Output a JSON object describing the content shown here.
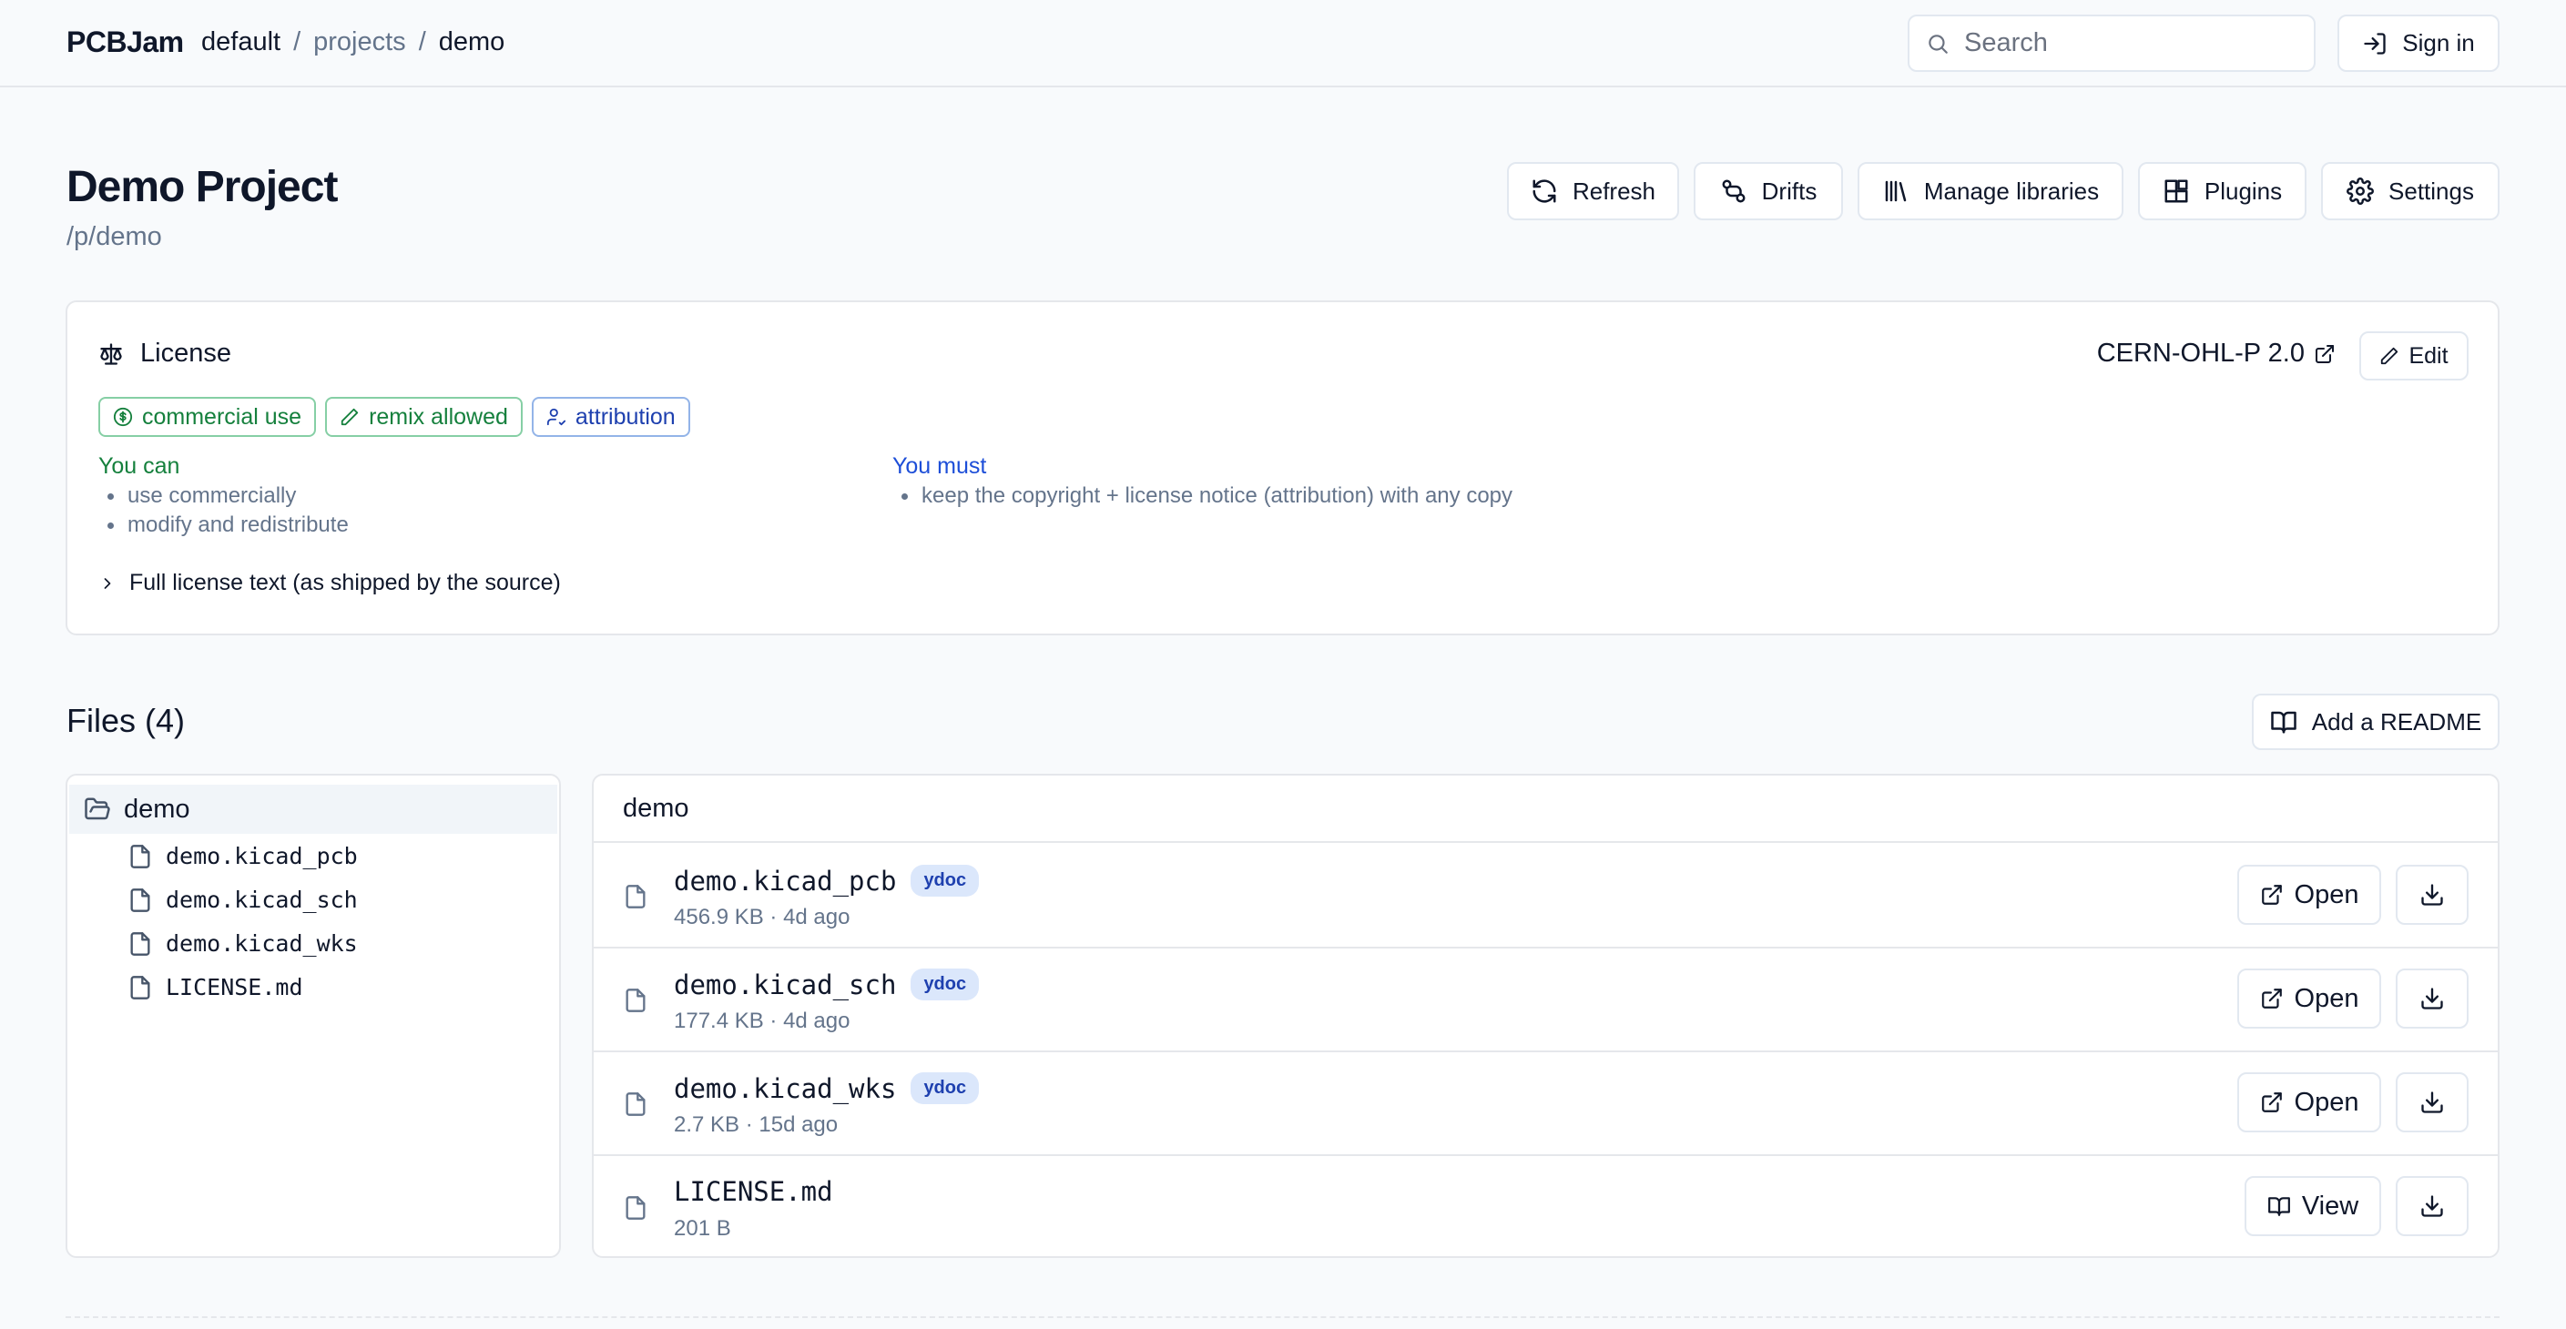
{
  "header": {
    "brand": "PCBJam",
    "breadcrumb": [
      "default",
      "projects",
      "demo"
    ],
    "search_placeholder": "Search",
    "signin_label": "Sign in"
  },
  "project": {
    "title": "Demo Project",
    "path": "/p/demo"
  },
  "toolbar": {
    "refresh": "Refresh",
    "drifts": "Drifts",
    "manage_libraries": "Manage libraries",
    "plugins": "Plugins",
    "settings": "Settings"
  },
  "license": {
    "heading": "License",
    "name": "CERN-OHL-P 2.0",
    "edit_label": "Edit",
    "badges": [
      "commercial use",
      "remix allowed",
      "attribution"
    ],
    "you_can_title": "You can",
    "you_can": [
      "use commercially",
      "modify and redistribute"
    ],
    "you_must_title": "You must",
    "you_must": [
      "keep the copyright + license notice (attribution) with any copy"
    ],
    "full_text_label": "Full license text (as shipped by the source)",
    "colors": {
      "can": "#15803d",
      "must": "#1d4ed8"
    }
  },
  "files": {
    "title": "Files (4)",
    "add_readme": "Add a README",
    "tree": {
      "root": "demo",
      "items": [
        "demo.kicad_pcb",
        "demo.kicad_sch",
        "demo.kicad_wks",
        "LICENSE.md"
      ]
    },
    "list_header": "demo",
    "rows": [
      {
        "name": "demo.kicad_pcb",
        "badge": "ydoc",
        "meta": "456.9 KB · 4d ago",
        "action": "Open"
      },
      {
        "name": "demo.kicad_sch",
        "badge": "ydoc",
        "meta": "177.4 KB · 4d ago",
        "action": "Open"
      },
      {
        "name": "demo.kicad_wks",
        "badge": "ydoc",
        "meta": "2.7 KB · 15d ago",
        "action": "Open"
      },
      {
        "name": "LICENSE.md",
        "badge": "",
        "meta": "201 B",
        "action": "View"
      }
    ]
  }
}
